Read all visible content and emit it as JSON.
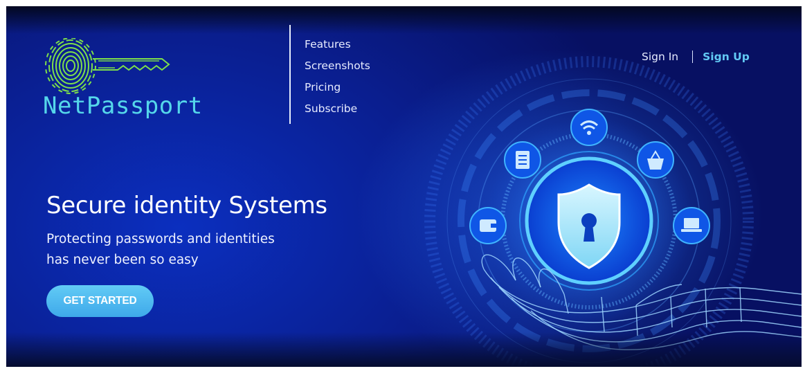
{
  "brand": {
    "name": "NetPassport"
  },
  "nav": {
    "items": [
      {
        "label": "Features"
      },
      {
        "label": "Screenshots"
      },
      {
        "label": "Pricing"
      },
      {
        "label": "Subscribe"
      }
    ]
  },
  "auth": {
    "signin_label": "Sign In",
    "signup_label": "Sign Up"
  },
  "hero": {
    "headline": "Secure identity Systems",
    "subline_1": "Protecting passwords and identities",
    "subline_2": "has never been so easy",
    "cta_label": "GET STARTED"
  },
  "colors": {
    "accent": "#5fcaf4",
    "logo_text": "#55d7ea",
    "background_dark": "#071062",
    "background_mid": "#0b2fbf"
  },
  "icons": {
    "logo": "fingerprint-key-icon",
    "orbit": [
      "wallet-icon",
      "notebook-icon",
      "wifi-icon",
      "shopping-basket-icon",
      "laptop-icon"
    ],
    "center": "shield-keyhole-icon",
    "hand": "wireframe-hand-icon"
  }
}
